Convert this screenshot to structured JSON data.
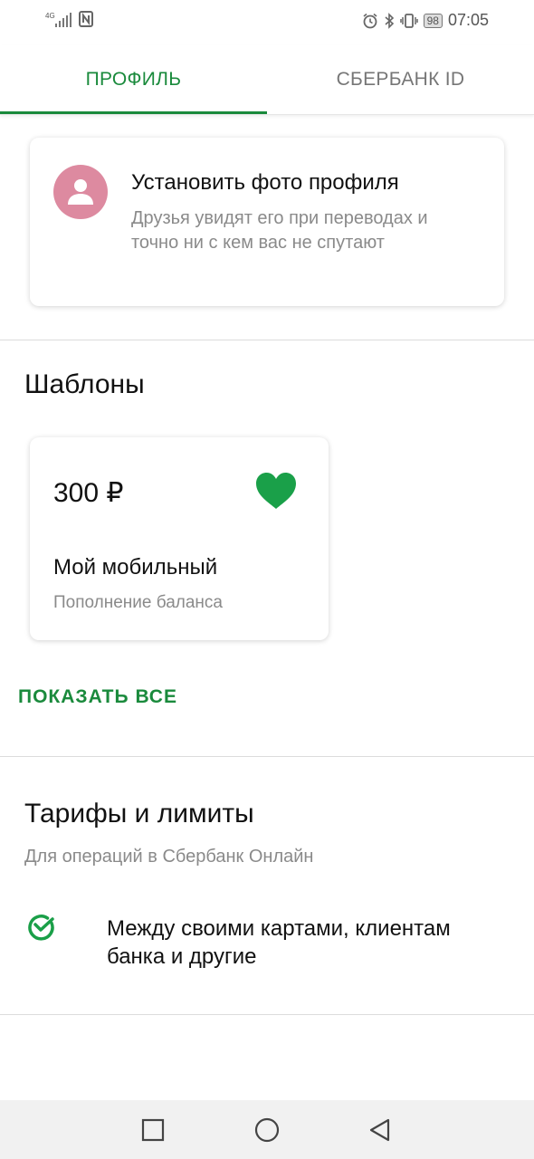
{
  "status_bar": {
    "network": "4G",
    "battery": "98",
    "time": "07:05"
  },
  "tabs": [
    {
      "label": "ПРОФИЛЬ",
      "active": true
    },
    {
      "label": "СБЕРБАНК ID",
      "active": false
    }
  ],
  "profile_card": {
    "icon": "person-icon",
    "title": "Установить фото профиля",
    "description": "Друзья увидят его при переводах и точно ни с кем вас не спутают"
  },
  "templates": {
    "title": "Шаблоны",
    "items": [
      {
        "amount": "300 ₽",
        "name": "Мой мобильный",
        "subtitle": "Пополнение баланса",
        "icon": "heart-icon"
      }
    ],
    "show_all": "ПОКАЗАТЬ ВСЕ"
  },
  "tariffs": {
    "title": "Тарифы и лимиты",
    "subtitle": "Для операций в Сбербанк Онлайн",
    "items": [
      {
        "icon": "sberbank-logo-icon",
        "label": "Между своими картами, клиентам банка и другие"
      }
    ]
  },
  "colors": {
    "accent": "#1a8a3c",
    "heart": "#1aa049",
    "avatar_bg": "#dd8aa0"
  }
}
